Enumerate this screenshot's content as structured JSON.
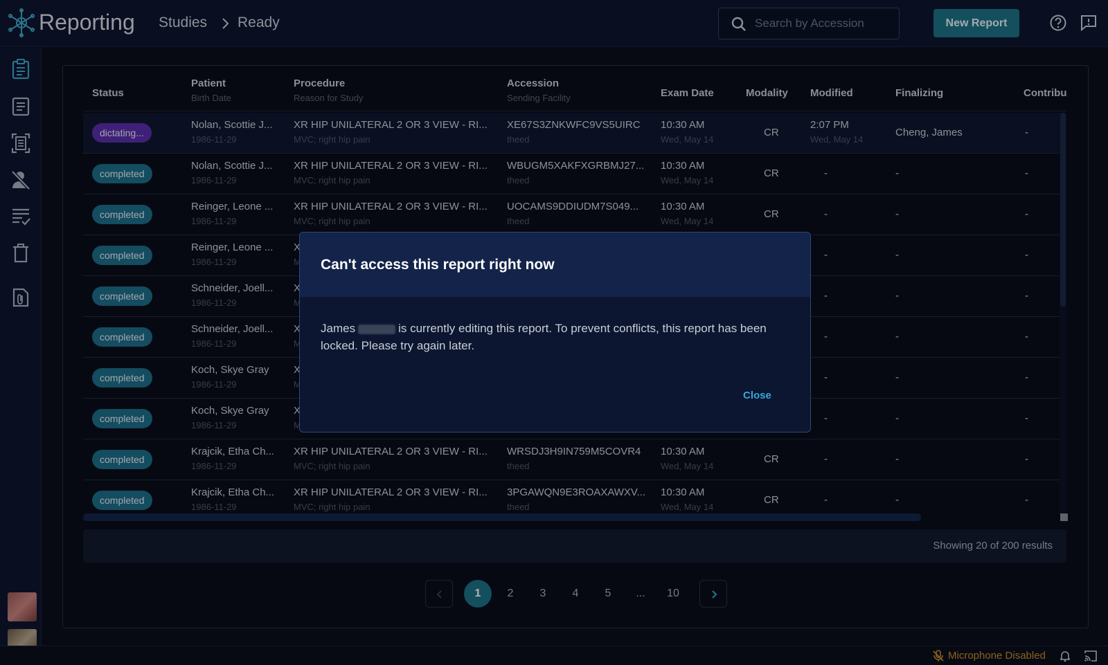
{
  "app": {
    "title": "Reporting"
  },
  "breadcrumb": {
    "studies": "Studies",
    "ready": "Ready"
  },
  "search": {
    "placeholder": "Search by Accession"
  },
  "toolbar": {
    "new_report": "New Report"
  },
  "colors": {
    "accent": "#1e7187",
    "dictating": "#5b2fae",
    "link": "#38a8d8",
    "warning": "#c98a2e"
  },
  "table": {
    "headers": {
      "status": "Status",
      "patient": "Patient",
      "patient_sub": "Birth Date",
      "procedure": "Procedure",
      "procedure_sub": "Reason for Study",
      "accession": "Accession",
      "accession_sub": "Sending Facility",
      "exam_date": "Exam Date",
      "modality": "Modality",
      "modified": "Modified",
      "finalizing": "Finalizing",
      "contrib": "Contribu"
    },
    "rows": [
      {
        "status": "dictating...",
        "patient": "Nolan, Scottie J...",
        "dob": "1986-11-29",
        "procedure": "XR HIP UNILATERAL 2 OR 3 VIEW - RI...",
        "reason": "MVC; right hip pain",
        "accession": "XE67S3ZNKWFC9VS5UIRC",
        "facility": "theed",
        "exam_time": "10:30 AM",
        "exam_day": "Wed, May 14",
        "modality": "CR",
        "modified": "2:07 PM",
        "modified_day": "Wed, May 14",
        "finalizing": "Cheng, James",
        "contrib": "-"
      },
      {
        "status": "completed",
        "patient": "Nolan, Scottie J...",
        "dob": "1986-11-29",
        "procedure": "XR HIP UNILATERAL 2 OR 3 VIEW - RI...",
        "reason": "MVC; right hip pain",
        "accession": "WBUGM5XAKFXGRBMJ27...",
        "facility": "theed",
        "exam_time": "10:30 AM",
        "exam_day": "Wed, May 14",
        "modality": "CR",
        "modified": "-",
        "modified_day": "",
        "finalizing": "-",
        "contrib": "-"
      },
      {
        "status": "completed",
        "patient": "Reinger, Leone ...",
        "dob": "1986-11-29",
        "procedure": "XR HIP UNILATERAL 2 OR 3 VIEW - RI...",
        "reason": "MVC; right hip pain",
        "accession": "UOCAMS9DDIUDM7S049...",
        "facility": "theed",
        "exam_time": "10:30 AM",
        "exam_day": "Wed, May 14",
        "modality": "CR",
        "modified": "-",
        "modified_day": "",
        "finalizing": "-",
        "contrib": "-"
      },
      {
        "status": "completed",
        "patient": "Reinger, Leone ...",
        "dob": "1986-11-29",
        "procedure": "X",
        "reason": "M",
        "accession": "",
        "facility": "",
        "exam_time": "",
        "exam_day": "",
        "modality": "",
        "modified": "-",
        "modified_day": "",
        "finalizing": "-",
        "contrib": "-"
      },
      {
        "status": "completed",
        "patient": "Schneider, Joell...",
        "dob": "1986-11-29",
        "procedure": "X",
        "reason": "M",
        "accession": "",
        "facility": "",
        "exam_time": "",
        "exam_day": "",
        "modality": "",
        "modified": "-",
        "modified_day": "",
        "finalizing": "-",
        "contrib": "-"
      },
      {
        "status": "completed",
        "patient": "Schneider, Joell...",
        "dob": "1986-11-29",
        "procedure": "X",
        "reason": "M",
        "accession": "",
        "facility": "",
        "exam_time": "",
        "exam_day": "",
        "modality": "",
        "modified": "-",
        "modified_day": "",
        "finalizing": "-",
        "contrib": "-"
      },
      {
        "status": "completed",
        "patient": "Koch, Skye Gray",
        "dob": "1986-11-29",
        "procedure": "X",
        "reason": "M",
        "accession": "",
        "facility": "",
        "exam_time": "",
        "exam_day": "",
        "modality": "",
        "modified": "-",
        "modified_day": "",
        "finalizing": "-",
        "contrib": "-"
      },
      {
        "status": "completed",
        "patient": "Koch, Skye Gray",
        "dob": "1986-11-29",
        "procedure": "X",
        "reason": "M",
        "accession": "",
        "facility": "",
        "exam_time": "",
        "exam_day": "",
        "modality": "",
        "modified": "-",
        "modified_day": "",
        "finalizing": "-",
        "contrib": "-"
      },
      {
        "status": "completed",
        "patient": "Krajcik, Etha Ch...",
        "dob": "1986-11-29",
        "procedure": "XR HIP UNILATERAL 2 OR 3 VIEW - RI...",
        "reason": "MVC; right hip pain",
        "accession": "WRSDJ3H9IN759M5COVR4",
        "facility": "theed",
        "exam_time": "10:30 AM",
        "exam_day": "Wed, May 14",
        "modality": "CR",
        "modified": "-",
        "modified_day": "",
        "finalizing": "-",
        "contrib": "-"
      },
      {
        "status": "completed",
        "patient": "Krajcik, Etha Ch...",
        "dob": "1986-11-29",
        "procedure": "XR HIP UNILATERAL 2 OR 3 VIEW - RI...",
        "reason": "MVC; right hip pain",
        "accession": "3PGAWQN9E3ROAXAWXV...",
        "facility": "theed",
        "exam_time": "10:30 AM",
        "exam_day": "Wed, May 14",
        "modality": "CR",
        "modified": "-",
        "modified_day": "",
        "finalizing": "-",
        "contrib": "-"
      }
    ]
  },
  "results": {
    "text": "Showing 20 of 200 results"
  },
  "pagination": {
    "pages": [
      "1",
      "2",
      "3",
      "4",
      "5",
      "...",
      "10"
    ],
    "current": "1"
  },
  "statusbar": {
    "mic": "Microphone Disabled"
  },
  "modal": {
    "title": "Can't access this report right now",
    "body_name": "James",
    "body_text": "is currently editing this report. To prevent conflicts, this report has been locked. Please try again later.",
    "close": "Close"
  }
}
